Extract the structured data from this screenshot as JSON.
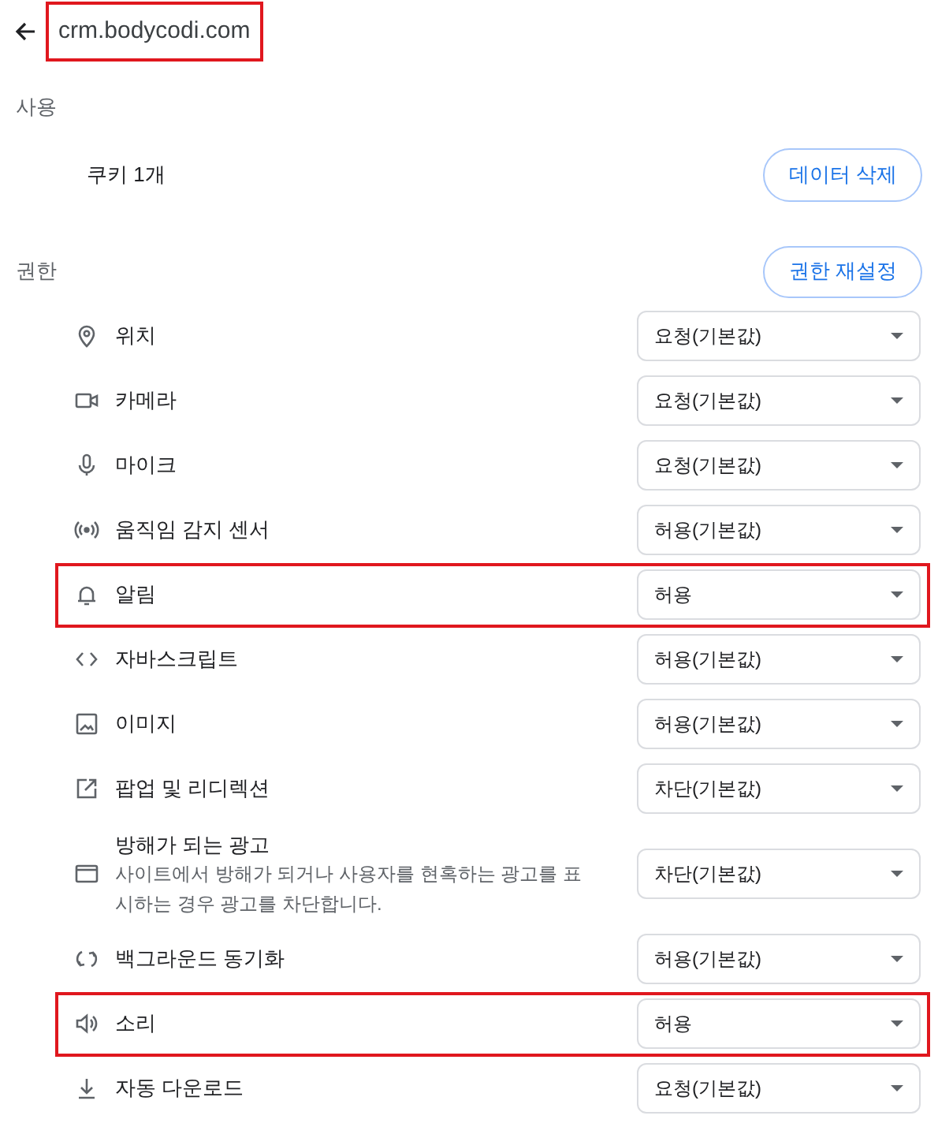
{
  "header": {
    "title": "crm.bodycodi.com",
    "highlighted": true
  },
  "usage": {
    "heading": "사용",
    "cookies": "쿠키 1개",
    "button": "데이터 삭제"
  },
  "permissions": {
    "heading": "권한",
    "reset_button": "권한 재설정",
    "items": [
      {
        "kind": "location",
        "label": "위치",
        "value": "요청(기본값)",
        "highlighted": false
      },
      {
        "kind": "camera",
        "label": "카메라",
        "value": "요청(기본값)",
        "highlighted": false
      },
      {
        "kind": "mic",
        "label": "마이크",
        "value": "요청(기본값)",
        "highlighted": false
      },
      {
        "kind": "sensor",
        "label": "움직임 감지 센서",
        "value": "허용(기본값)",
        "highlighted": false
      },
      {
        "kind": "bell",
        "label": "알림",
        "value": "허용",
        "highlighted": true
      },
      {
        "kind": "code",
        "label": "자바스크립트",
        "value": "허용(기본값)",
        "highlighted": false
      },
      {
        "kind": "image",
        "label": "이미지",
        "value": "허용(기본값)",
        "highlighted": false
      },
      {
        "kind": "popup",
        "label": "팝업 및 리디렉션",
        "value": "차단(기본값)",
        "highlighted": false
      },
      {
        "kind": "ads",
        "label": "방해가 되는 광고",
        "description": "사이트에서 방해가 되거나 사용자를 현혹하는 광고를 표시하는 경우 광고를 차단합니다.",
        "value": "차단(기본값)",
        "highlighted": false
      },
      {
        "kind": "sync",
        "label": "백그라운드 동기화",
        "value": "허용(기본값)",
        "highlighted": false
      },
      {
        "kind": "sound",
        "label": "소리",
        "value": "허용",
        "highlighted": true
      },
      {
        "kind": "download",
        "label": "자동 다운로드",
        "value": "요청(기본값)",
        "highlighted": false
      }
    ]
  }
}
